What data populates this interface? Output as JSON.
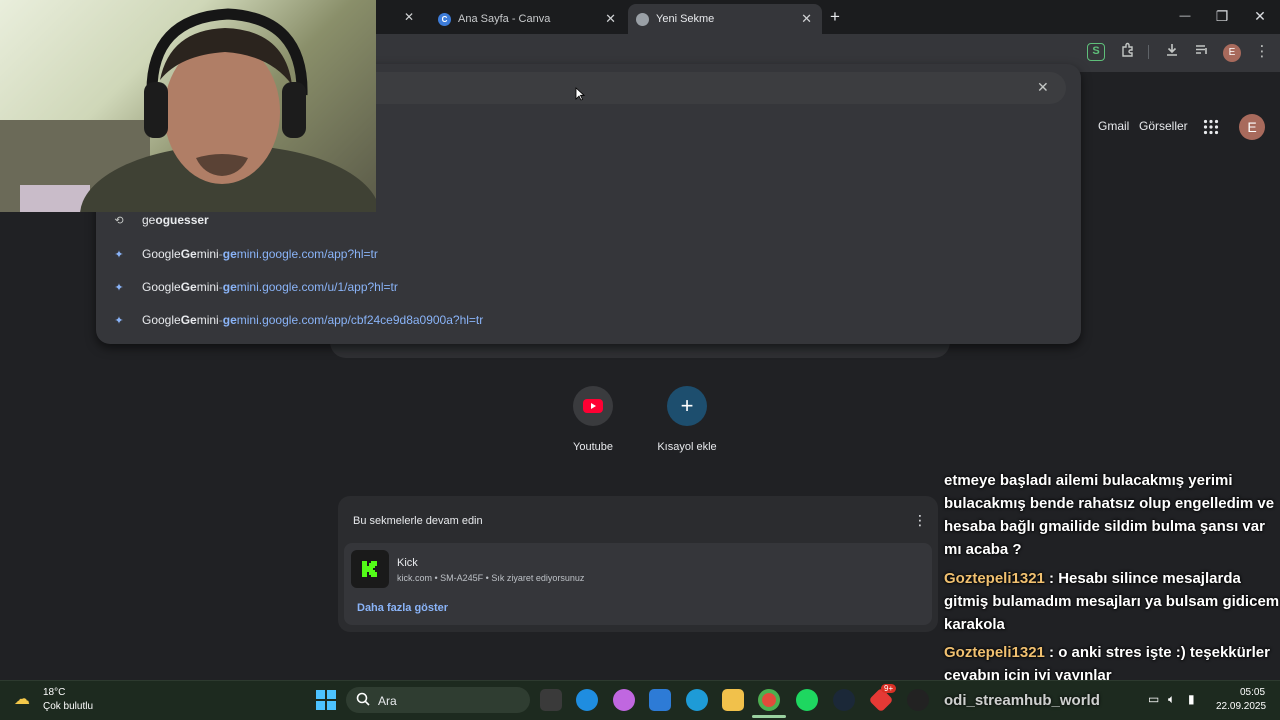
{
  "tabs": [
    {
      "title": "Ana Sayfa - Canva",
      "close": "✕",
      "active": false
    },
    {
      "title": "Yeni Sekme",
      "close": "✕",
      "active": true
    }
  ],
  "tabs_partial_close": "✕",
  "new_tab": "+",
  "window": {
    "minimize": "—",
    "maximize": "❐",
    "close": "✕"
  },
  "toolbar": {
    "profile_initial": "E",
    "ext_s": "S",
    "clear": "✕"
  },
  "suggestions": [
    {
      "prefix": "ge",
      "bold": "oguesser",
      "icon": "history-icon"
    },
    {
      "site_a": "Google ",
      "site_b": "Ge",
      "site_c": "mini",
      "sep": " - ",
      "url_bold": "ge",
      "url_rest": "mini.google.com/app?hl=tr"
    },
    {
      "site_a": "Google ",
      "site_b": "Ge",
      "site_c": "mini",
      "sep": " - ",
      "url_bold": "ge",
      "url_rest": "mini.google.com/u/1/app?hl=tr"
    },
    {
      "site_a": "Google ",
      "site_b": "Ge",
      "site_c": "mini",
      "sep": " - ",
      "url_bold": "ge",
      "url_rest": "mini.google.com/app/cbf24ce9d8a0900a?hl=tr"
    }
  ],
  "google": {
    "gmail": "Gmail",
    "images": "Görseller",
    "avatar": "E"
  },
  "shortcuts": [
    {
      "label": "Youtube"
    },
    {
      "label": "Kısayol ekle",
      "icon_text": "+"
    }
  ],
  "continue": {
    "title": "Bu sekmelerle devam edin",
    "menu": "⋮",
    "item_title": "Kick",
    "item_sub": "kick.com • SM-A245F • Sık ziyaret ediyorsunuz",
    "more": "Daha fazla göster"
  },
  "chat": {
    "line1": "etmeye başladı ailemi bulacakmış yerimi bulacakmış bende rahatsız olup engelledim ve hesaba bağlı gmailide sildim bulma şansı var mı acaba ?",
    "user2": "Goztepeli1321",
    "msg2": " : Hesabı silince mesajlarda gitmiş bulamadım mesajları ya bulsam gidicem karakola",
    "user3": "Goztepeli1321",
    "msg3": " : o anki stres işte :) teşekkürler cevabın için iyi yayınlar"
  },
  "taskbar": {
    "temp": "18°C",
    "weather": "Çok bulutlu",
    "search": "Ara",
    "watermark": "odi_streamhub_world",
    "time": "05:05",
    "date": "22.09.2025",
    "badge": "9+"
  }
}
